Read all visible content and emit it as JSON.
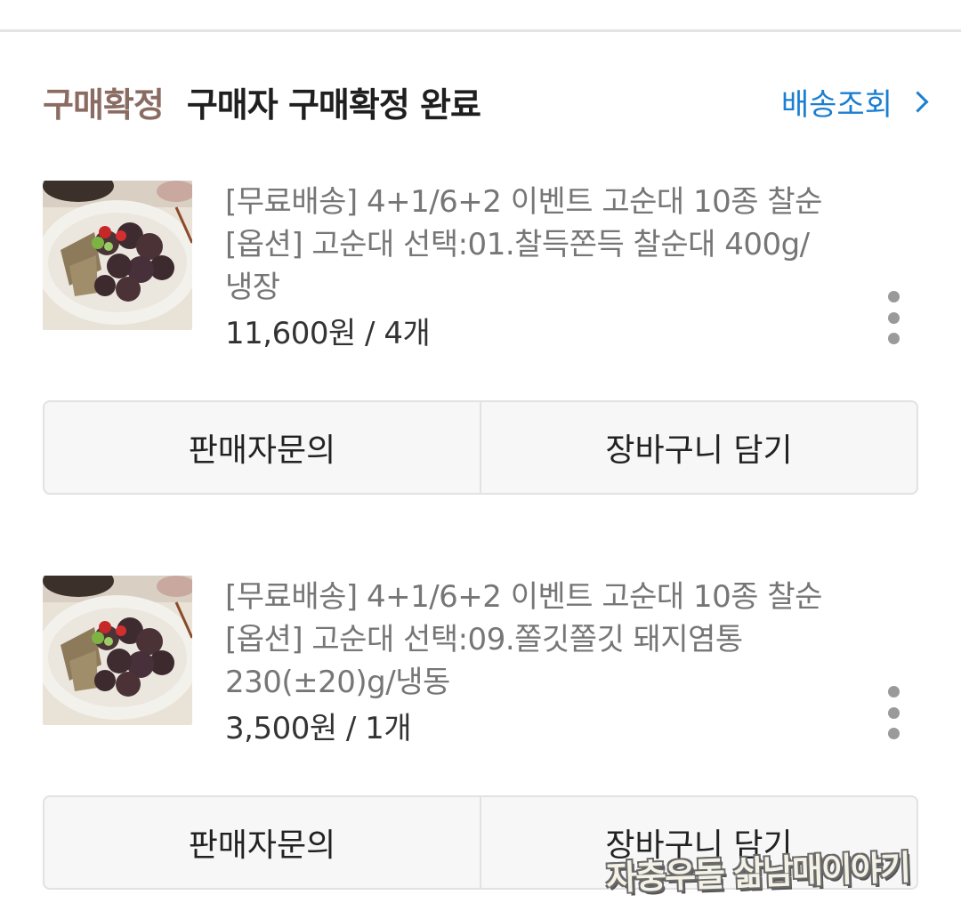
{
  "order": {
    "status_label": "구매확정",
    "status_desc": "구매자 구매확정 완료",
    "track_label": "배송조회"
  },
  "items": [
    {
      "title": "[무료배송] 4+1/6+2 이벤트 고순대 10종 찰순",
      "option_line1": "[옵션] 고순대 선택:01.찰득쫀득 찰순대 400g/",
      "option_line2": "냉장",
      "price": "11,600원 / 4개",
      "thumbnail_icon": "sundae-plate-image"
    },
    {
      "title": "[무료배송] 4+1/6+2 이벤트 고순대 10종 찰순",
      "option_line1": "[옵션] 고순대 선택:09.쫄깃쫄깃 돼지염통",
      "option_line2": "230(±20)g/냉동",
      "price": "3,500원 / 1개",
      "thumbnail_icon": "sundae-plate-image"
    }
  ],
  "actions": {
    "inquiry_label": "판매자문의",
    "cart_label": "장바구니 담기"
  },
  "watermark": "자충우돌 삶남매이야기",
  "colors": {
    "status_label": "#8a6c62",
    "link": "#1a7fd1",
    "divider": "#e4e4e4"
  }
}
